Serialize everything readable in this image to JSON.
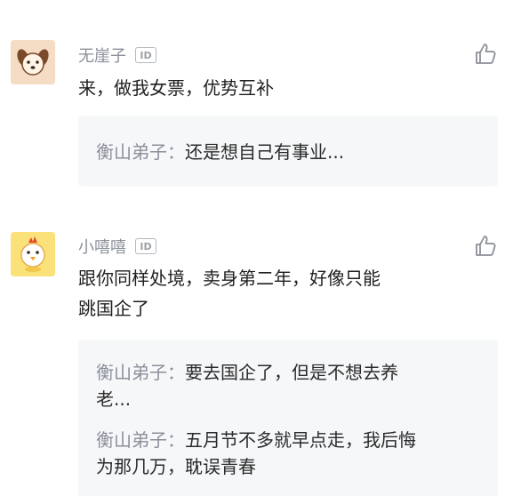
{
  "comments": [
    {
      "username": "无崖子",
      "id_badge": "ID",
      "text": "来，做我女票，优势互补",
      "avatar_icon": "dog-face-icon",
      "like_icon": "thumbs-up-icon",
      "replies": [
        {
          "author": "衡山弟子：",
          "text": "还是想自己有事业..."
        }
      ]
    },
    {
      "username": "小嘻嘻",
      "id_badge": "ID",
      "text_line1": "跟你同样处境，卖身第二年，好像只能",
      "text_line2": "跳国企了",
      "avatar_icon": "chicken-icon",
      "like_icon": "thumbs-up-icon",
      "replies": [
        {
          "author": "衡山弟子：",
          "text_line1": "要去国企了，但是不想去养",
          "text_line2": "老..."
        },
        {
          "author": "衡山弟子：",
          "text_line1": "五月节不多就早点走，我后悔",
          "text_line2": "为那几万，耽误青春"
        }
      ]
    }
  ],
  "colors": {
    "username": "#8a8f99",
    "text": "#1f1f1f",
    "reply_bg": "#f6f7f9",
    "avatar1_bg": "#f5dcc4",
    "avatar2_bg": "#fbe17a"
  }
}
